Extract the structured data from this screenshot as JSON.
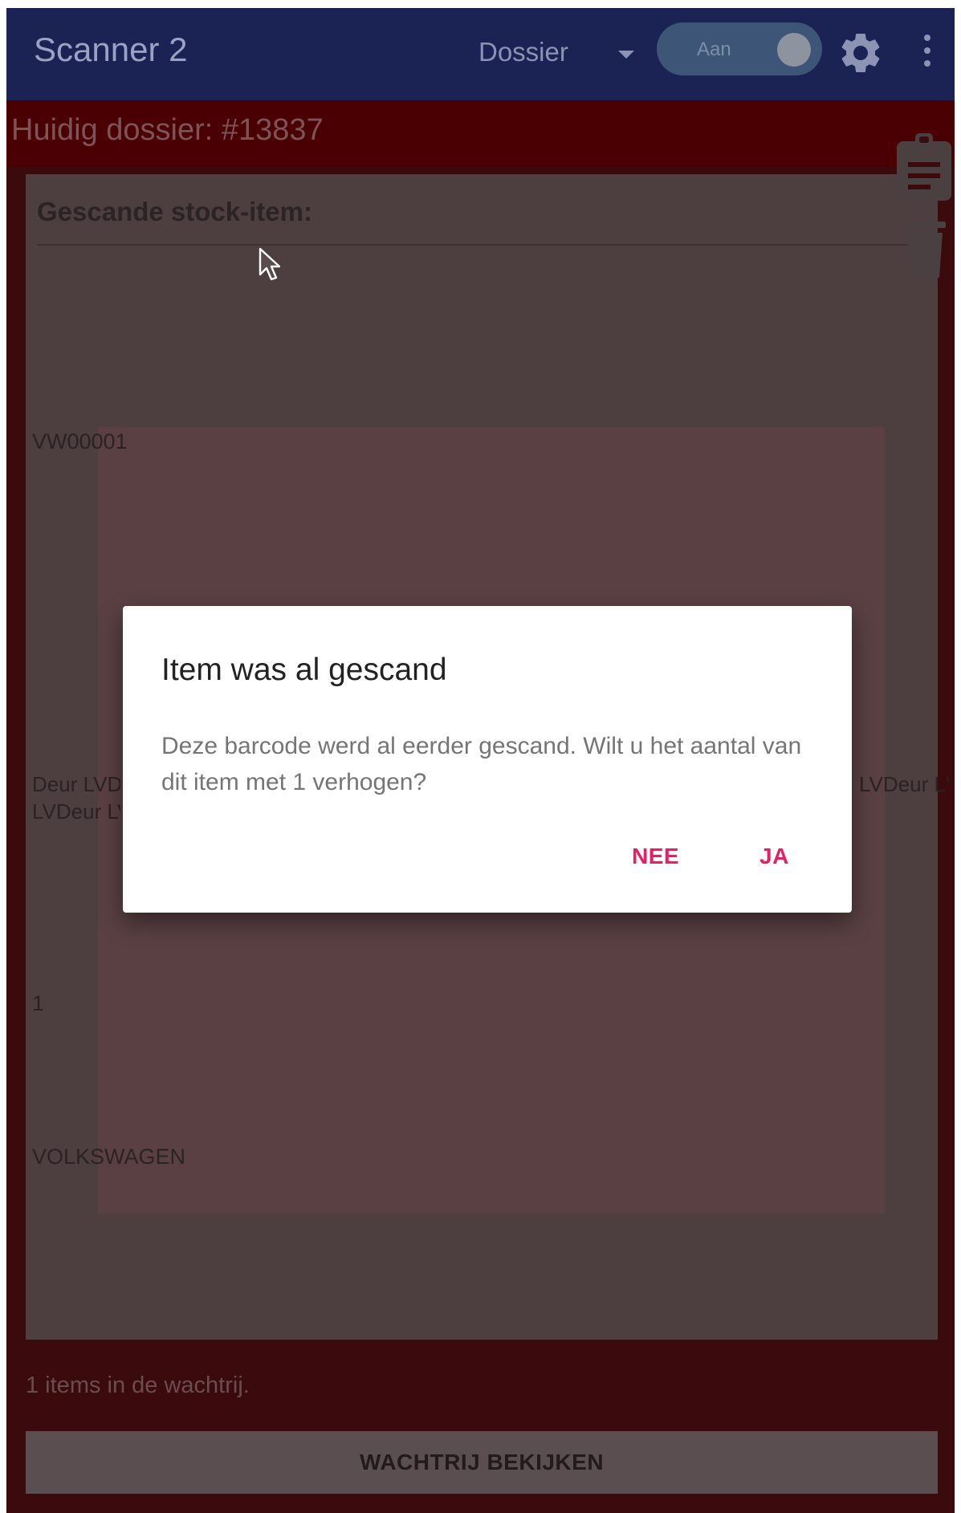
{
  "app_bar": {
    "title": "Scanner 2",
    "mode_select": "Dossier",
    "toggle_label": "Aan"
  },
  "current_dossier": "Huidig dossier: #13837",
  "card": {
    "title": "Gescande stock-item:",
    "code": "VW00001",
    "description_left": "Deur LVD\nLVDeur LV",
    "description_right": "LVDeur L'",
    "quantity": "1",
    "brand": "VOLKSWAGEN"
  },
  "queue": {
    "status": "1 items in de wachtrij.",
    "button_label": "WACHTRIJ BEKIJKEN"
  },
  "dialog": {
    "title": "Item was al gescand",
    "message": "Deze barcode werd al eerder gescand. Wilt u het aantal van dit item met 1 verhogen?",
    "negative_label": "NEE",
    "positive_label": "JA"
  },
  "colors": {
    "app_bar": "#1a2353",
    "dossier_band": "#4a0003",
    "dialog_accent": "#e91e63"
  },
  "icons": [
    "gear-icon",
    "more-vert-icon",
    "dropdown-caret-icon",
    "clipboard-icon",
    "trash-icon",
    "mouse-cursor-icon"
  ]
}
